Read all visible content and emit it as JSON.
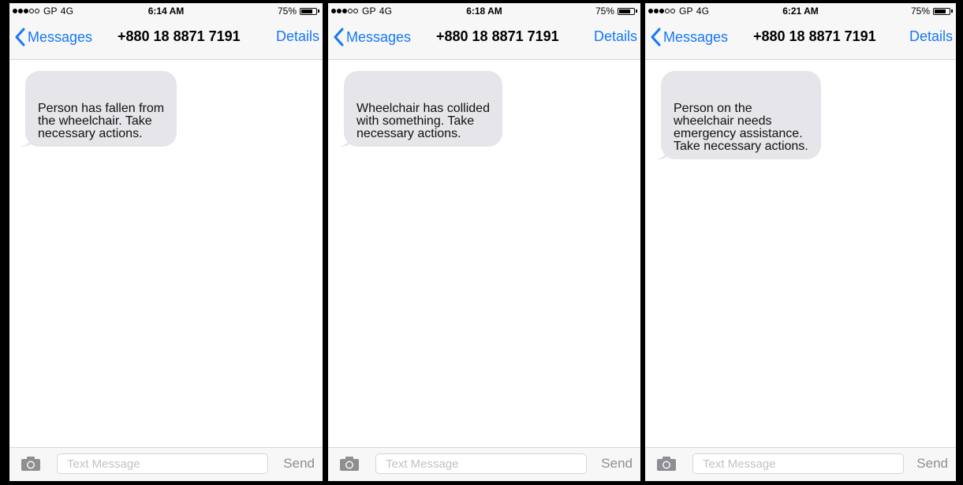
{
  "phones": [
    {
      "status": {
        "carrier": "GP",
        "network": "4G",
        "time": "6:14 AM",
        "battery": "75%",
        "battery_level": 0.75,
        "signal_bars_filled": 3,
        "signal_bars_total": 5
      },
      "nav": {
        "back_label": "Messages",
        "contact": "+880 18 8871 7191",
        "details_label": "Details"
      },
      "message": {
        "text": "Person has fallen from\nthe wheelchair. Take\nnecessary actions."
      },
      "composer": {
        "placeholder": "Text Message",
        "send_label": "Send"
      }
    },
    {
      "status": {
        "carrier": "GP",
        "network": "4G",
        "time": "6:18 AM",
        "battery": "75%",
        "battery_level": 0.75,
        "signal_bars_filled": 3,
        "signal_bars_total": 5
      },
      "nav": {
        "back_label": "Messages",
        "contact": "+880 18 8871 7191",
        "details_label": "Details"
      },
      "message": {
        "text": "Wheelchair has collided\nwith something. Take\nnecessary actions."
      },
      "composer": {
        "placeholder": "Text Message",
        "send_label": "Send"
      }
    },
    {
      "status": {
        "carrier": "GP",
        "network": "4G",
        "time": "6:21 AM",
        "battery": "75%",
        "battery_level": 0.75,
        "signal_bars_filled": 3,
        "signal_bars_total": 5
      },
      "nav": {
        "back_label": "Messages",
        "contact": "+880 18 8871 7191",
        "details_label": "Details"
      },
      "message": {
        "text": "Person on the\nwheelchair needs\nemergency assistance.\nTake necessary actions."
      },
      "composer": {
        "placeholder": "Text Message",
        "send_label": "Send"
      }
    }
  ],
  "icons": {
    "back": "chevron-left-icon",
    "camera": "camera-icon",
    "battery": "battery-icon",
    "signal": "signal-dots-icon"
  },
  "colors": {
    "accent": "#1577f7",
    "bubble": "#e5e5ea",
    "bar": "#f7f7f8",
    "frame": "#000000"
  }
}
